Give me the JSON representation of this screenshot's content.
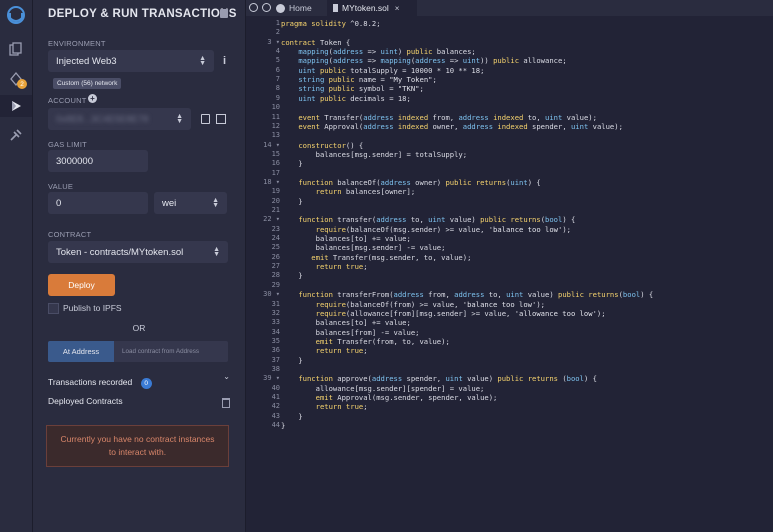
{
  "sidebar": {
    "icons": [
      "remix-logo-icon",
      "file-explorer-icon",
      "solidity-compiler-icon",
      "deploy-run-icon",
      "plugin-manager-icon"
    ],
    "compiler_badge": "2"
  },
  "panel": {
    "title": "DEPLOY & RUN TRANSACTIONS",
    "environment_label": "ENVIRONMENT",
    "environment_value": "Injected Web3",
    "network_badge": "Custom (56) network",
    "account_label": "ACCOUNT",
    "account_value": "0x8E8...3C4E5E8E78",
    "gas_limit_label": "GAS LIMIT",
    "gas_limit_value": "3000000",
    "value_label": "VALUE",
    "value_amount": "0",
    "value_unit": "wei",
    "contract_label": "CONTRACT",
    "contract_value": "Token - contracts/MYtoken.sol",
    "deploy_label": "Deploy",
    "ipfs_label": "Publish to IPFS",
    "or_label": "OR",
    "at_address_label": "At Address",
    "load_contract_placeholder": "Load contract from Address",
    "transactions_label": "Transactions recorded",
    "transactions_count": "0",
    "deployed_label": "Deployed Contracts",
    "empty_message": "Currently you have no contract instances to interact with."
  },
  "editor": {
    "tabs": [
      {
        "label": "Home"
      },
      {
        "label": "MYtoken.sol"
      }
    ],
    "lines": [
      "pragma solidity ^0.8.2;",
      "",
      "contract Token {",
      "    mapping(address => uint) public balances;",
      "    mapping(address => mapping(address => uint)) public allowance;",
      "    uint public totalSupply = 10000 * 10 ** 18;",
      "    string public name = \"My Token\";",
      "    string public symbol = \"TKN\";",
      "    uint public decimals = 18;",
      "",
      "    event Transfer(address indexed from, address indexed to, uint value);",
      "    event Approval(address indexed owner, address indexed spender, uint value);",
      "",
      "    constructor() {",
      "        balances[msg.sender] = totalSupply;",
      "    }",
      "",
      "    function balanceOf(address owner) public returns(uint) {",
      "        return balances[owner];",
      "    }",
      "",
      "    function transfer(address to, uint value) public returns(bool) {",
      "        require(balanceOf(msg.sender) >= value, 'balance too low');",
      "        balances[to] += value;",
      "        balances[msg.sender] -= value;",
      "       emit Transfer(msg.sender, to, value);",
      "        return true;",
      "    }",
      "",
      "    function transferFrom(address from, address to, uint value) public returns(bool) {",
      "        require(balanceOf(from) >= value, 'balance too low');",
      "        require(allowance[from][msg.sender] >= value, 'allowance too low');",
      "        balances[to] += value;",
      "        balances[from] -= value;",
      "        emit Transfer(from, to, value);",
      "        return true;",
      "    }",
      "",
      "    function approve(address spender, uint value) public returns (bool) {",
      "        allowance[msg.sender][spender] = value;",
      "        emit Approval(msg.sender, spender, value);",
      "        return true;",
      "    }",
      "}"
    ],
    "folded_lines": [
      3,
      14,
      18,
      22,
      30,
      39
    ]
  }
}
